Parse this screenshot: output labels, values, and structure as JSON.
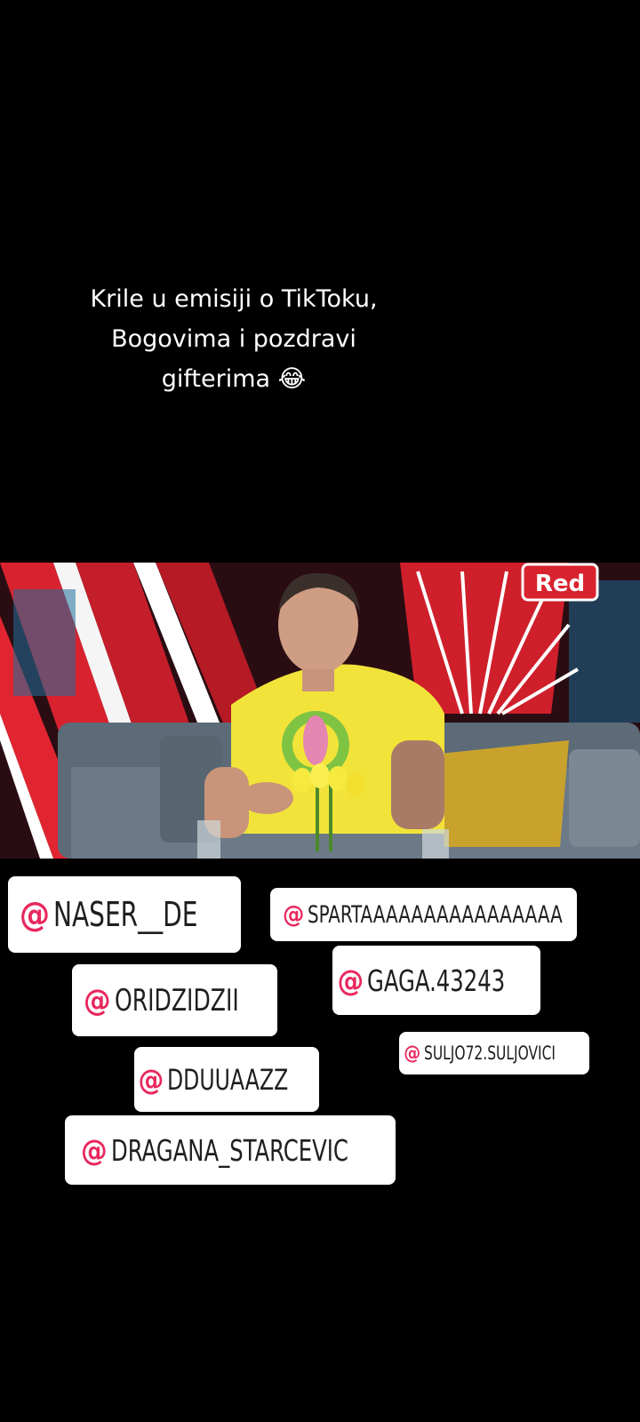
{
  "caption": {
    "line1": "Krile u emisiji o TikToku,",
    "line2": "Bogovima i pozdravi",
    "line3": "gifterima 😂"
  },
  "video": {
    "channel_logo": "Red"
  },
  "mentions": [
    {
      "at": "@",
      "name": "NASER__DE"
    },
    {
      "at": "@",
      "name": "SPARTAAAAAAAAAAAAAAAA"
    },
    {
      "at": "@",
      "name": "ORIDZIDZII"
    },
    {
      "at": "@",
      "name": "GAGA.43243"
    },
    {
      "at": "@",
      "name": "SULJO72.SULJOVICI"
    },
    {
      "at": "@",
      "name": "DDUUAAZZ"
    },
    {
      "at": "@",
      "name": "DRAGANA_STARCEVIC"
    }
  ],
  "colors": {
    "background": "#000000",
    "mention_accent": "#e8285d",
    "tag_background": "#ffffff",
    "shirt": "#f2e33a",
    "studio_red": "#d8232f"
  }
}
